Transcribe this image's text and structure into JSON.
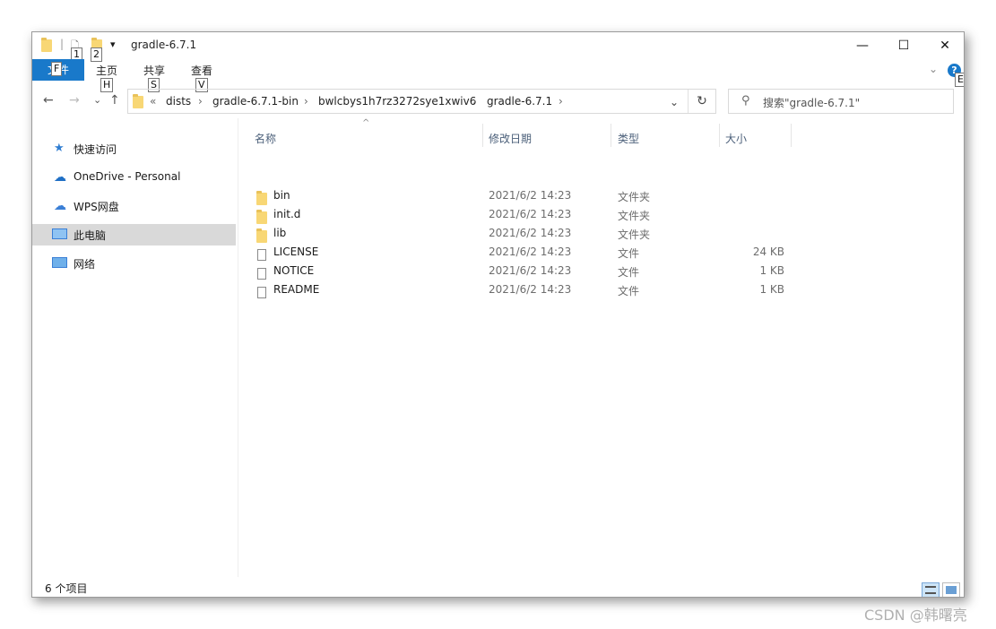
{
  "window": {
    "title": "gradle-6.7.1",
    "quick_access": {
      "keytip1": "1",
      "keytip2": "2",
      "dropdown": "▾"
    },
    "controls": {
      "minimize": "—",
      "maximize": "☐",
      "close": "✕"
    }
  },
  "ribbon": {
    "file_tab": "文件",
    "file_keytip": "F",
    "tabs": [
      {
        "label": "主页",
        "keytip": "H"
      },
      {
        "label": "共享",
        "keytip": "S"
      },
      {
        "label": "查看",
        "keytip": "V"
      }
    ],
    "expand": "⌄",
    "help": "?",
    "help_keytip": "E"
  },
  "address": {
    "back": "←",
    "forward": "→",
    "recent": "⌄",
    "up": "↑",
    "overflow": "«",
    "breadcrumbs": [
      "dists",
      "gradle-6.7.1-bin",
      "bwlcbys1h7rz3272sye1xwiv6",
      "gradle-6.7.1"
    ],
    "separator": "›",
    "history_dropdown": "⌄",
    "refresh": "↻",
    "search_placeholder": "搜索\"gradle-6.7.1\""
  },
  "nav": {
    "items": [
      {
        "label": "快速访问",
        "icon": "star-icon"
      },
      {
        "label": "OneDrive - Personal",
        "icon": "cloud-icon"
      },
      {
        "label": "WPS网盘",
        "icon": "wps-cloud-icon"
      },
      {
        "label": "此电脑",
        "icon": "computer-icon",
        "selected": true
      },
      {
        "label": "网络",
        "icon": "network-icon"
      }
    ]
  },
  "columns": {
    "name": "名称",
    "date": "修改日期",
    "type": "类型",
    "size": "大小",
    "sort_indicator": "^"
  },
  "files": [
    {
      "name": "bin",
      "date": "2021/6/2 14:23",
      "type": "文件夹",
      "size": "",
      "icon": "folder-icon"
    },
    {
      "name": "init.d",
      "date": "2021/6/2 14:23",
      "type": "文件夹",
      "size": "",
      "icon": "folder-icon"
    },
    {
      "name": "lib",
      "date": "2021/6/2 14:23",
      "type": "文件夹",
      "size": "",
      "icon": "folder-icon"
    },
    {
      "name": "LICENSE",
      "date": "2021/6/2 14:23",
      "type": "文件",
      "size": "24 KB",
      "icon": "file-icon"
    },
    {
      "name": "NOTICE",
      "date": "2021/6/2 14:23",
      "type": "文件",
      "size": "1 KB",
      "icon": "file-icon"
    },
    {
      "name": "README",
      "date": "2021/6/2 14:23",
      "type": "文件",
      "size": "1 KB",
      "icon": "file-icon"
    }
  ],
  "status": {
    "item_count": "6 个项目"
  },
  "watermark": "CSDN @韩曙亮",
  "colors": {
    "accent": "#1979ca",
    "selected_nav": "#d9d9d9",
    "folder": "#f8d775",
    "header_text": "#4c607a"
  }
}
